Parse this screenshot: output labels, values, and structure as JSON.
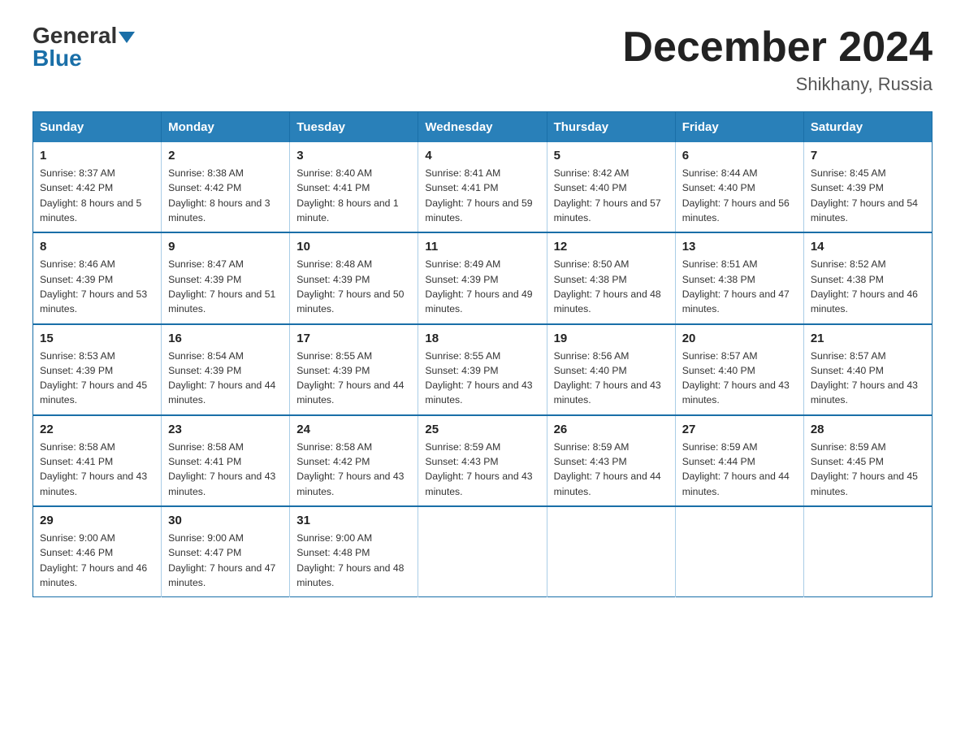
{
  "header": {
    "logo_general": "General",
    "logo_blue": "Blue",
    "month_year": "December 2024",
    "location": "Shikhany, Russia"
  },
  "days_of_week": [
    "Sunday",
    "Monday",
    "Tuesday",
    "Wednesday",
    "Thursday",
    "Friday",
    "Saturday"
  ],
  "weeks": [
    [
      {
        "day": "1",
        "sunrise": "8:37 AM",
        "sunset": "4:42 PM",
        "daylight": "8 hours and 5 minutes."
      },
      {
        "day": "2",
        "sunrise": "8:38 AM",
        "sunset": "4:42 PM",
        "daylight": "8 hours and 3 minutes."
      },
      {
        "day": "3",
        "sunrise": "8:40 AM",
        "sunset": "4:41 PM",
        "daylight": "8 hours and 1 minute."
      },
      {
        "day": "4",
        "sunrise": "8:41 AM",
        "sunset": "4:41 PM",
        "daylight": "7 hours and 59 minutes."
      },
      {
        "day": "5",
        "sunrise": "8:42 AM",
        "sunset": "4:40 PM",
        "daylight": "7 hours and 57 minutes."
      },
      {
        "day": "6",
        "sunrise": "8:44 AM",
        "sunset": "4:40 PM",
        "daylight": "7 hours and 56 minutes."
      },
      {
        "day": "7",
        "sunrise": "8:45 AM",
        "sunset": "4:39 PM",
        "daylight": "7 hours and 54 minutes."
      }
    ],
    [
      {
        "day": "8",
        "sunrise": "8:46 AM",
        "sunset": "4:39 PM",
        "daylight": "7 hours and 53 minutes."
      },
      {
        "day": "9",
        "sunrise": "8:47 AM",
        "sunset": "4:39 PM",
        "daylight": "7 hours and 51 minutes."
      },
      {
        "day": "10",
        "sunrise": "8:48 AM",
        "sunset": "4:39 PM",
        "daylight": "7 hours and 50 minutes."
      },
      {
        "day": "11",
        "sunrise": "8:49 AM",
        "sunset": "4:39 PM",
        "daylight": "7 hours and 49 minutes."
      },
      {
        "day": "12",
        "sunrise": "8:50 AM",
        "sunset": "4:38 PM",
        "daylight": "7 hours and 48 minutes."
      },
      {
        "day": "13",
        "sunrise": "8:51 AM",
        "sunset": "4:38 PM",
        "daylight": "7 hours and 47 minutes."
      },
      {
        "day": "14",
        "sunrise": "8:52 AM",
        "sunset": "4:38 PM",
        "daylight": "7 hours and 46 minutes."
      }
    ],
    [
      {
        "day": "15",
        "sunrise": "8:53 AM",
        "sunset": "4:39 PM",
        "daylight": "7 hours and 45 minutes."
      },
      {
        "day": "16",
        "sunrise": "8:54 AM",
        "sunset": "4:39 PM",
        "daylight": "7 hours and 44 minutes."
      },
      {
        "day": "17",
        "sunrise": "8:55 AM",
        "sunset": "4:39 PM",
        "daylight": "7 hours and 44 minutes."
      },
      {
        "day": "18",
        "sunrise": "8:55 AM",
        "sunset": "4:39 PM",
        "daylight": "7 hours and 43 minutes."
      },
      {
        "day": "19",
        "sunrise": "8:56 AM",
        "sunset": "4:40 PM",
        "daylight": "7 hours and 43 minutes."
      },
      {
        "day": "20",
        "sunrise": "8:57 AM",
        "sunset": "4:40 PM",
        "daylight": "7 hours and 43 minutes."
      },
      {
        "day": "21",
        "sunrise": "8:57 AM",
        "sunset": "4:40 PM",
        "daylight": "7 hours and 43 minutes."
      }
    ],
    [
      {
        "day": "22",
        "sunrise": "8:58 AM",
        "sunset": "4:41 PM",
        "daylight": "7 hours and 43 minutes."
      },
      {
        "day": "23",
        "sunrise": "8:58 AM",
        "sunset": "4:41 PM",
        "daylight": "7 hours and 43 minutes."
      },
      {
        "day": "24",
        "sunrise": "8:58 AM",
        "sunset": "4:42 PM",
        "daylight": "7 hours and 43 minutes."
      },
      {
        "day": "25",
        "sunrise": "8:59 AM",
        "sunset": "4:43 PM",
        "daylight": "7 hours and 43 minutes."
      },
      {
        "day": "26",
        "sunrise": "8:59 AM",
        "sunset": "4:43 PM",
        "daylight": "7 hours and 44 minutes."
      },
      {
        "day": "27",
        "sunrise": "8:59 AM",
        "sunset": "4:44 PM",
        "daylight": "7 hours and 44 minutes."
      },
      {
        "day": "28",
        "sunrise": "8:59 AM",
        "sunset": "4:45 PM",
        "daylight": "7 hours and 45 minutes."
      }
    ],
    [
      {
        "day": "29",
        "sunrise": "9:00 AM",
        "sunset": "4:46 PM",
        "daylight": "7 hours and 46 minutes."
      },
      {
        "day": "30",
        "sunrise": "9:00 AM",
        "sunset": "4:47 PM",
        "daylight": "7 hours and 47 minutes."
      },
      {
        "day": "31",
        "sunrise": "9:00 AM",
        "sunset": "4:48 PM",
        "daylight": "7 hours and 48 minutes."
      },
      null,
      null,
      null,
      null
    ]
  ]
}
